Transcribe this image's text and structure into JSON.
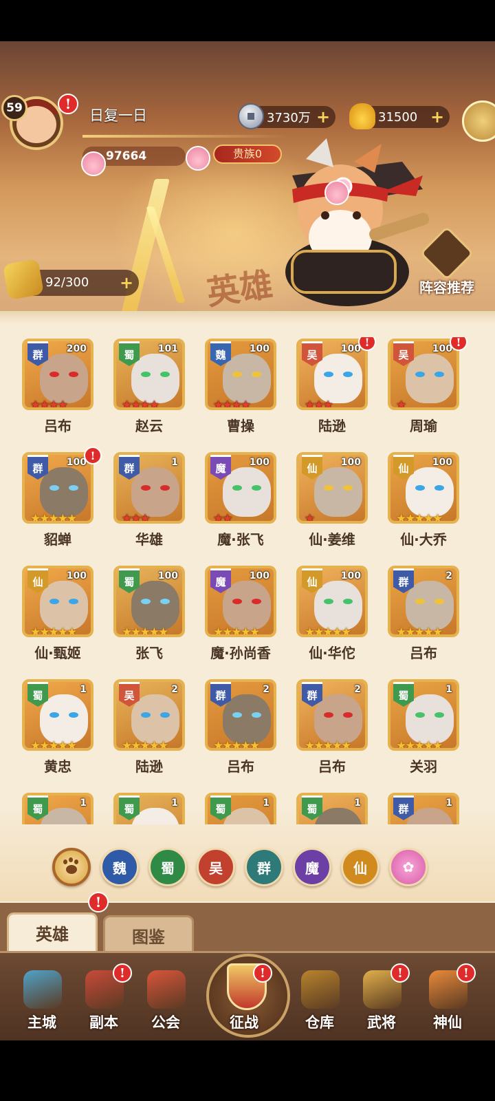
{
  "player": {
    "level": "59",
    "name": "日复一日",
    "power": "97664",
    "noble": "贵族0",
    "alert_mark": "!"
  },
  "currency": {
    "silver": "3730万",
    "gold": "31500",
    "plus": "+"
  },
  "recruit": {
    "count": "92/300",
    "plus": "+"
  },
  "banner": {
    "watermark": "英雄",
    "lineup_label": "阵容推荐"
  },
  "faction_colors": {
    "群": "#3f5ba8",
    "蜀": "#3f9a4e",
    "魏": "#3866b0",
    "吴": "#d0553b",
    "魔": "#7b4bb5",
    "仙": "#d39a2a"
  },
  "heroes": [
    {
      "name": "吕布",
      "faction": "群",
      "level": "200",
      "stars": 4,
      "star_color": "red",
      "alert": false
    },
    {
      "name": "赵云",
      "faction": "蜀",
      "level": "101",
      "stars": 4,
      "star_color": "red",
      "alert": false
    },
    {
      "name": "曹操",
      "faction": "魏",
      "level": "100",
      "stars": 4,
      "star_color": "red",
      "alert": false
    },
    {
      "name": "陆逊",
      "faction": "吴",
      "level": "100",
      "stars": 3,
      "star_color": "red",
      "alert": true
    },
    {
      "name": "周瑜",
      "faction": "吴",
      "level": "100",
      "stars": 1,
      "star_color": "red",
      "alert": true
    },
    {
      "name": "貂蝉",
      "faction": "群",
      "level": "100",
      "stars": 5,
      "star_color": "gold",
      "alert": true
    },
    {
      "name": "华雄",
      "faction": "群",
      "level": "1",
      "stars": 3,
      "star_color": "red",
      "alert": false
    },
    {
      "name": "魔·张飞",
      "faction": "魔",
      "level": "100",
      "stars": 2,
      "star_color": "red",
      "alert": false
    },
    {
      "name": "仙·姜维",
      "faction": "仙",
      "level": "100",
      "stars": 1,
      "star_color": "red",
      "alert": false
    },
    {
      "name": "仙·大乔",
      "faction": "仙",
      "level": "100",
      "stars": 5,
      "star_color": "gold",
      "alert": false
    },
    {
      "name": "仙·甄姬",
      "faction": "仙",
      "level": "100",
      "stars": 5,
      "star_color": "gold",
      "alert": false
    },
    {
      "name": "张飞",
      "faction": "蜀",
      "level": "100",
      "stars": 5,
      "star_color": "gold",
      "alert": false
    },
    {
      "name": "魔·孙尚香",
      "faction": "魔",
      "level": "100",
      "stars": 5,
      "star_color": "gold",
      "alert": false
    },
    {
      "name": "仙·华佗",
      "faction": "仙",
      "level": "100",
      "stars": 5,
      "star_color": "gold",
      "alert": false
    },
    {
      "name": "吕布",
      "faction": "群",
      "level": "2",
      "stars": 5,
      "star_color": "gold",
      "alert": false
    },
    {
      "name": "黄忠",
      "faction": "蜀",
      "level": "1",
      "stars": 5,
      "star_color": "gold",
      "alert": false
    },
    {
      "name": "陆逊",
      "faction": "吴",
      "level": "2",
      "stars": 5,
      "star_color": "gold",
      "alert": false
    },
    {
      "name": "吕布",
      "faction": "群",
      "level": "2",
      "stars": 5,
      "star_color": "gold",
      "alert": false
    },
    {
      "name": "吕布",
      "faction": "群",
      "level": "2",
      "stars": 5,
      "star_color": "gold",
      "alert": false
    },
    {
      "name": "关羽",
      "faction": "蜀",
      "level": "1",
      "stars": 5,
      "star_color": "gold",
      "alert": false
    },
    {
      "name": "",
      "faction": "蜀",
      "level": "1",
      "stars": 0,
      "star_color": "gold",
      "alert": false
    },
    {
      "name": "",
      "faction": "蜀",
      "level": "1",
      "stars": 0,
      "star_color": "gold",
      "alert": false
    },
    {
      "name": "",
      "faction": "蜀",
      "level": "1",
      "stars": 0,
      "star_color": "gold",
      "alert": false
    },
    {
      "name": "",
      "faction": "蜀",
      "level": "1",
      "stars": 0,
      "star_color": "gold",
      "alert": false
    },
    {
      "name": "",
      "faction": "群",
      "level": "1",
      "stars": 0,
      "star_color": "gold",
      "alert": false
    }
  ],
  "filters": [
    {
      "label": "",
      "icon": "paw-icon",
      "color": "#d9a13e"
    },
    {
      "label": "魏",
      "color": "#2f5aa8"
    },
    {
      "label": "蜀",
      "color": "#2f8a45"
    },
    {
      "label": "吴",
      "color": "#c2402e"
    },
    {
      "label": "群",
      "color": "#2d7a78"
    },
    {
      "label": "魔",
      "color": "#6b3fa5"
    },
    {
      "label": "仙",
      "color": "#d08a1e"
    },
    {
      "label": "",
      "icon": "swirl-icon",
      "color": "#d85aa8"
    }
  ],
  "tabs": {
    "heroes": "英雄",
    "codex": "图鉴"
  },
  "nav": [
    {
      "label": "主城",
      "icon": "castle-icon",
      "alert": false
    },
    {
      "label": "副本",
      "icon": "sword-icon",
      "alert": true
    },
    {
      "label": "公会",
      "icon": "banner-icon",
      "alert": false
    },
    {
      "label": "征战",
      "icon": "battle-icon",
      "alert": true
    },
    {
      "label": "仓库",
      "icon": "bag-icon",
      "alert": false
    },
    {
      "label": "武将",
      "icon": "general-icon",
      "alert": true
    },
    {
      "label": "神仙",
      "icon": "cat-god-icon",
      "alert": true
    }
  ]
}
